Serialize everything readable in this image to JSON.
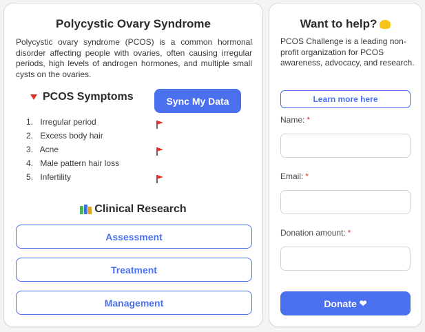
{
  "left_card": {
    "title": "Polycystic Ovary Syndrome",
    "description": "Polycystic ovary syndrome (PCOS) is a common hormonal disorder affecting people with ovaries, often causing irregular periods, high levels of androgen hormones, and multiple small cysts on the ovaries.",
    "symptoms_heading": "PCOS Symptoms",
    "sync_button_label": "Sync My Data",
    "symptoms": [
      {
        "number": "1.",
        "label": "Irregular period"
      },
      {
        "number": "2.",
        "label": "Excess body hair"
      },
      {
        "number": "3.",
        "label": "Acne"
      },
      {
        "number": "4.",
        "label": "Male pattern hair loss"
      },
      {
        "number": "5.",
        "label": "Infertility"
      }
    ],
    "research_heading": "Clinical Research",
    "research_buttons": [
      {
        "label": "Assessment"
      },
      {
        "label": "Treatment"
      },
      {
        "label": "Management"
      }
    ]
  },
  "right_card": {
    "title": "Want to help?",
    "description": "PCOS Challenge is a leading non-profit organization for PCOS awareness, advocacy, and research.",
    "learn_more_label": "Learn more here",
    "fields": {
      "name_label": "Name:",
      "name_value": "",
      "email_label": "Email:",
      "email_value": "",
      "donation_label": "Donation amount:",
      "donation_value": "",
      "required_marker": "*"
    },
    "donate_label": "Donate",
    "donate_icon": "❤"
  },
  "icons": {
    "symptoms_icon": "triangle-down-icon",
    "flag_icon": "red-flag-icon",
    "research_icon": "books-icon",
    "help_icon": "handshake-icon",
    "donate_icon": "heart-icon"
  },
  "colors": {
    "accent": "#4a70ed",
    "flag": "#e0312b",
    "required": "#e0312b"
  }
}
